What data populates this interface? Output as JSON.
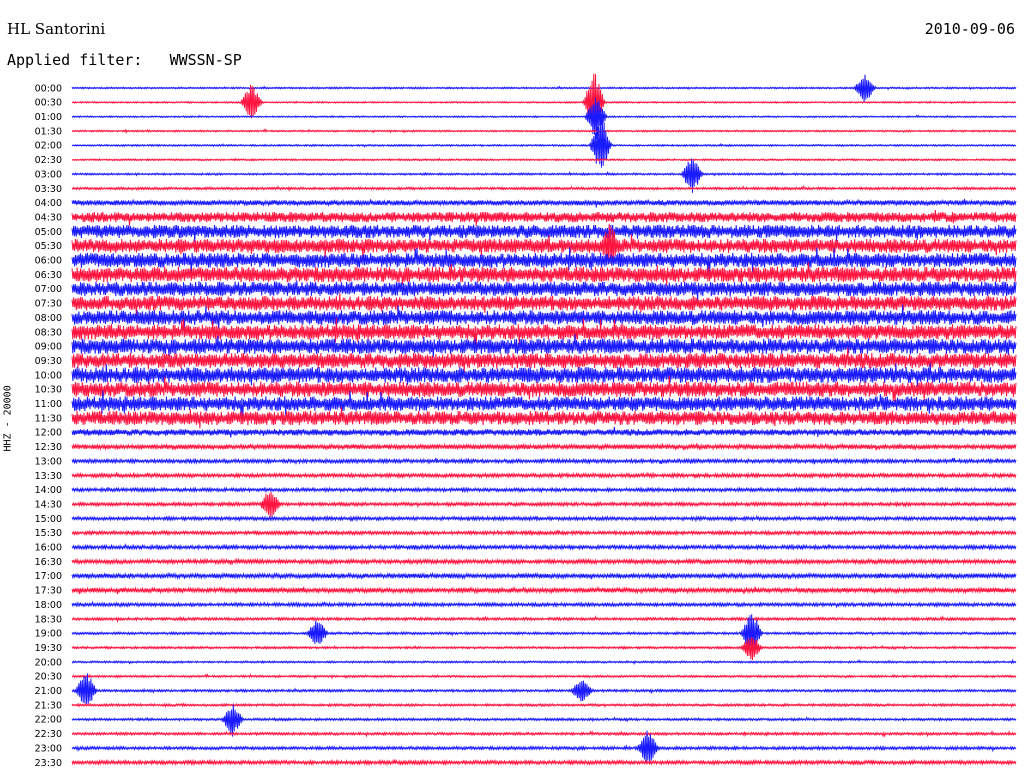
{
  "header": {
    "station": "HL Santorini",
    "date": "2010-09-06",
    "filter_label": "Applied filter:",
    "filter_value": "WWSSN-SP"
  },
  "channel_label": "HHZ - 20000",
  "colors": {
    "blue": "#1a1aff",
    "red": "#ff1440",
    "background": "#ffffff"
  },
  "chart_data": {
    "type": "line",
    "title": "HL Santorini",
    "subtitle": "Applied filter: WWSSN-SP",
    "ylabel": "HHZ - 20000",
    "row_labels": [
      "00:00",
      "00:30",
      "01:00",
      "01:30",
      "02:00",
      "02:30",
      "03:00",
      "03:30",
      "04:00",
      "04:30",
      "05:00",
      "05:30",
      "06:00",
      "06:30",
      "07:00",
      "07:30",
      "08:00",
      "08:30",
      "09:00",
      "09:30",
      "10:00",
      "10:30",
      "11:00",
      "11:30",
      "12:00",
      "12:30",
      "13:00",
      "13:30",
      "14:00",
      "14:30",
      "15:00",
      "15:30",
      "16:00",
      "16:30",
      "17:00",
      "17:30",
      "18:00",
      "18:30",
      "19:00",
      "19:30",
      "20:00",
      "20:30",
      "21:00",
      "21:30",
      "22:00",
      "22:30",
      "23:00",
      "23:30"
    ],
    "row_colors": [
      "blue",
      "red"
    ],
    "row_amplitude": [
      0.25,
      0.22,
      0.22,
      0.25,
      0.25,
      0.25,
      0.28,
      0.35,
      0.8,
      1.6,
      2.1,
      2.2,
      2.3,
      2.4,
      2.3,
      2.3,
      2.3,
      2.4,
      2.4,
      2.4,
      2.5,
      2.4,
      2.3,
      2.2,
      1.0,
      0.7,
      0.55,
      0.55,
      0.5,
      0.5,
      0.5,
      0.5,
      0.55,
      0.6,
      0.7,
      0.7,
      0.5,
      0.4,
      0.35,
      0.32,
      0.28,
      0.3,
      0.35,
      0.35,
      0.35,
      0.38,
      0.45,
      0.55
    ],
    "events": [
      {
        "row": 0,
        "at": 0.84,
        "amp": 1.6
      },
      {
        "row": 1,
        "at": 0.19,
        "amp": 2.0
      },
      {
        "row": 1,
        "at": 0.553,
        "amp": 3.5
      },
      {
        "row": 2,
        "at": 0.555,
        "amp": 2.5
      },
      {
        "row": 4,
        "at": 0.56,
        "amp": 3.5
      },
      {
        "row": 6,
        "at": 0.657,
        "amp": 2.2
      },
      {
        "row": 11,
        "at": 0.57,
        "amp": 2.5
      },
      {
        "row": 29,
        "at": 0.21,
        "amp": 1.8
      },
      {
        "row": 38,
        "at": 0.26,
        "amp": 1.6
      },
      {
        "row": 38,
        "at": 0.72,
        "amp": 2.6
      },
      {
        "row": 39,
        "at": 0.72,
        "amp": 1.6
      },
      {
        "row": 42,
        "at": 0.015,
        "amp": 2.2
      },
      {
        "row": 42,
        "at": 0.54,
        "amp": 1.6
      },
      {
        "row": 44,
        "at": 0.17,
        "amp": 1.8
      },
      {
        "row": 46,
        "at": 0.61,
        "amp": 2.0
      }
    ],
    "grid": false,
    "legend": "none"
  }
}
